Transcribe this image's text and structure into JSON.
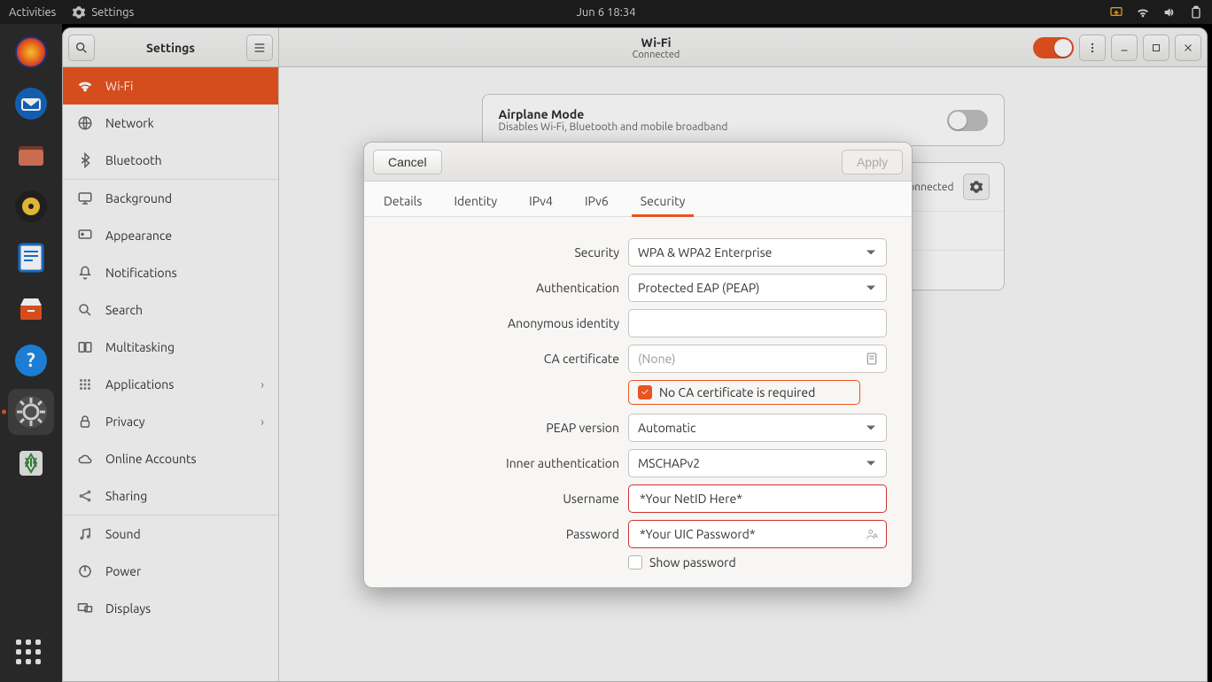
{
  "topbar": {
    "activities": "Activities",
    "app_name": "Settings",
    "clock": "Jun 6  18:34"
  },
  "dock": {
    "items": [
      {
        "name": "firefox-icon"
      },
      {
        "name": "thunderbird-icon"
      },
      {
        "name": "files-icon"
      },
      {
        "name": "rhythmbox-icon"
      },
      {
        "name": "writer-icon"
      },
      {
        "name": "software-icon"
      },
      {
        "name": "help-icon"
      },
      {
        "name": "settings-icon"
      },
      {
        "name": "trash-icon"
      }
    ]
  },
  "window": {
    "sidebar_title": "Settings",
    "header_title": "Wi-Fi",
    "header_subtitle": "Connected"
  },
  "sidebar": {
    "items": [
      {
        "label": "Wi-Fi",
        "icon": "wifi-icon",
        "selected": true
      },
      {
        "label": "Network",
        "icon": "globe-icon"
      },
      {
        "label": "Bluetooth",
        "icon": "bluetooth-icon"
      },
      {
        "label": "Background",
        "icon": "monitor-icon",
        "sep_before": true
      },
      {
        "label": "Appearance",
        "icon": "appearance-icon"
      },
      {
        "label": "Notifications",
        "icon": "bell-icon"
      },
      {
        "label": "Search",
        "icon": "search-icon"
      },
      {
        "label": "Multitasking",
        "icon": "multitasking-icon"
      },
      {
        "label": "Applications",
        "icon": "apps-icon",
        "chevron": true
      },
      {
        "label": "Privacy",
        "icon": "lock-icon",
        "chevron": true
      },
      {
        "label": "Online Accounts",
        "icon": "cloud-icon"
      },
      {
        "label": "Sharing",
        "icon": "share-icon"
      },
      {
        "label": "Sound",
        "icon": "music-icon",
        "sep_before": true
      },
      {
        "label": "Power",
        "icon": "power-icon"
      },
      {
        "label": "Displays",
        "icon": "displays-icon"
      }
    ]
  },
  "content": {
    "airplane_title": "Airplane Mode",
    "airplane_desc": "Disables Wi-Fi, Bluetooth and mobile broadband",
    "connected_chip": "Connected"
  },
  "dialog": {
    "cancel": "Cancel",
    "apply": "Apply",
    "tabs": [
      "Details",
      "Identity",
      "IPv4",
      "IPv6",
      "Security"
    ],
    "active_tab": 4,
    "labels": {
      "security": "Security",
      "authentication": "Authentication",
      "anon_identity": "Anonymous identity",
      "ca_cert": "CA certificate",
      "no_ca": "No CA certificate is required",
      "peap_version": "PEAP version",
      "inner_auth": "Inner authentication",
      "username": "Username",
      "password": "Password",
      "show_password": "Show password"
    },
    "values": {
      "security": "WPA & WPA2 Enterprise",
      "authentication": "Protected EAP (PEAP)",
      "anon_identity": "",
      "ca_cert": "(None)",
      "no_ca_checked": true,
      "peap_version": "Automatic",
      "inner_auth": "MSCHAPv2",
      "username": "*Your NetID Here*",
      "password": "*Your UIC Password*",
      "show_password_checked": false
    }
  }
}
